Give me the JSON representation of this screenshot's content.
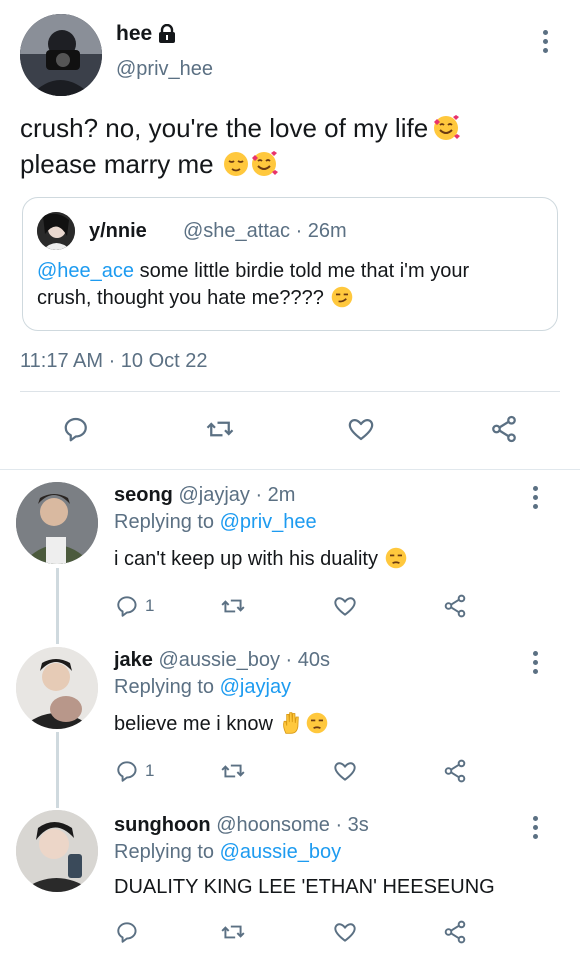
{
  "tweet": {
    "name": "hee",
    "handle": "@priv_hee",
    "text_line1": "crush? no, you're the love of my life",
    "text_line2": "please marry me",
    "timestamp": "11:17 AM · 10 Oct 22",
    "quote": {
      "name": "y/nnie",
      "handle_time": "@she_attac · 26m",
      "mention": "@hee_ace",
      "text_line1_rest": " some little birdie told me that i'm your",
      "text_line2": "crush, thought you hate me????"
    }
  },
  "replies": [
    {
      "name": "seong",
      "handle_time": " @jayjay · 2m",
      "replying_label": "Replying to ",
      "replying_to": "@priv_hee",
      "text": "i can't keep up with his duality",
      "reply_count": "1"
    },
    {
      "name": "jake",
      "handle_time": " @aussie_boy · 40s",
      "replying_label": "Replying to ",
      "replying_to": "@jayjay",
      "text": "believe me i know",
      "reply_count": "1"
    },
    {
      "name": "sunghoon",
      "handle_time": " @hoonsome · 3s",
      "replying_label": "Replying to ",
      "replying_to": "@aussie_boy",
      "text": "DUALITY KING LEE 'ETHAN' HEESEUNG",
      "reply_count": ""
    }
  ],
  "icons": {
    "lock": "lock-icon",
    "more": "more-icon",
    "reply": "reply-icon",
    "retweet": "retweet-icon",
    "like": "heart-icon",
    "share": "share-icon"
  },
  "colors": {
    "accent": "#1d9bf0",
    "secondary_text": "#5b7083",
    "icon": "#5b7083"
  }
}
